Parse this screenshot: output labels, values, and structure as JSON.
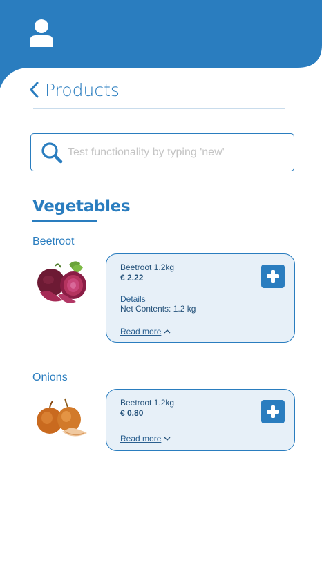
{
  "header": {
    "title": "Products",
    "accent_color": "#2a7dbf"
  },
  "search": {
    "placeholder": "Test functionality by typing 'new'",
    "value": ""
  },
  "section": {
    "title": "Vegetables"
  },
  "products": [
    {
      "name": "Beetroot",
      "card_title": "Beetroot 1.2kg",
      "price": "€ 2.22",
      "details_label": "Details",
      "net_contents": "Net Contents:  1.2 kg",
      "read_more": "Read more",
      "expanded": true,
      "icon": "beetroot-image"
    },
    {
      "name": "Onions",
      "card_title": "Beetroot 1.2kg",
      "price": "€ 0.80",
      "read_more": "Read more",
      "expanded": false,
      "icon": "onion-image"
    }
  ]
}
